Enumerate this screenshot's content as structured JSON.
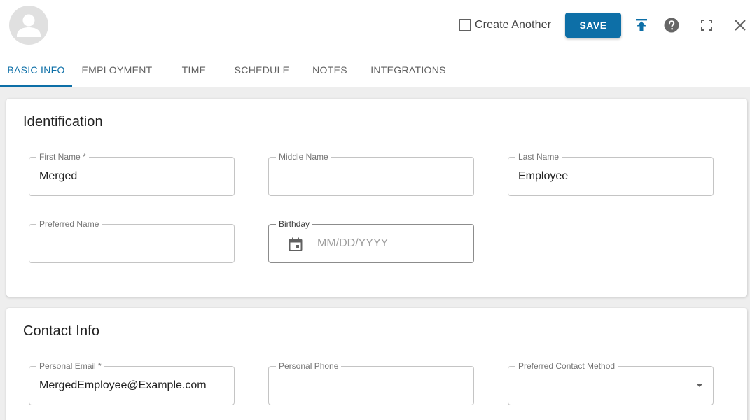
{
  "header": {
    "create_another_label": "Create Another",
    "create_another_checked": false,
    "save_label": "SAVE"
  },
  "tabs": [
    {
      "label": "BASIC INFO",
      "active": true
    },
    {
      "label": "EMPLOYMENT",
      "active": false
    },
    {
      "label": "TIME",
      "active": false
    },
    {
      "label": "SCHEDULE",
      "active": false
    },
    {
      "label": "NOTES",
      "active": false
    },
    {
      "label": "INTEGRATIONS",
      "active": false
    }
  ],
  "identification": {
    "title": "Identification",
    "first_name": {
      "label": "First Name *",
      "value": "Merged"
    },
    "middle_name": {
      "label": "Middle Name",
      "value": ""
    },
    "last_name": {
      "label": "Last Name",
      "value": "Employee"
    },
    "preferred_name": {
      "label": "Preferred Name",
      "value": ""
    },
    "birthday": {
      "label": "Birthday",
      "placeholder": "MM/DD/YYYY"
    }
  },
  "contact": {
    "title": "Contact Info",
    "personal_email": {
      "label": "Personal Email *",
      "value": "MergedEmployee@Example.com"
    },
    "personal_phone": {
      "label": "Personal Phone",
      "value": ""
    },
    "preferred_contact_method": {
      "label": "Preferred Contact Method",
      "value": ""
    }
  },
  "icons": {
    "avatar": "person-icon",
    "publish": "upload-icon",
    "help": "help-circle-icon",
    "fullscreen": "fullscreen-icon",
    "close": "close-icon",
    "calendar": "calendar-icon",
    "dropdown": "chevron-down-icon"
  },
  "colors": {
    "accent": "#0d6fa7",
    "background": "#eeeeee"
  }
}
